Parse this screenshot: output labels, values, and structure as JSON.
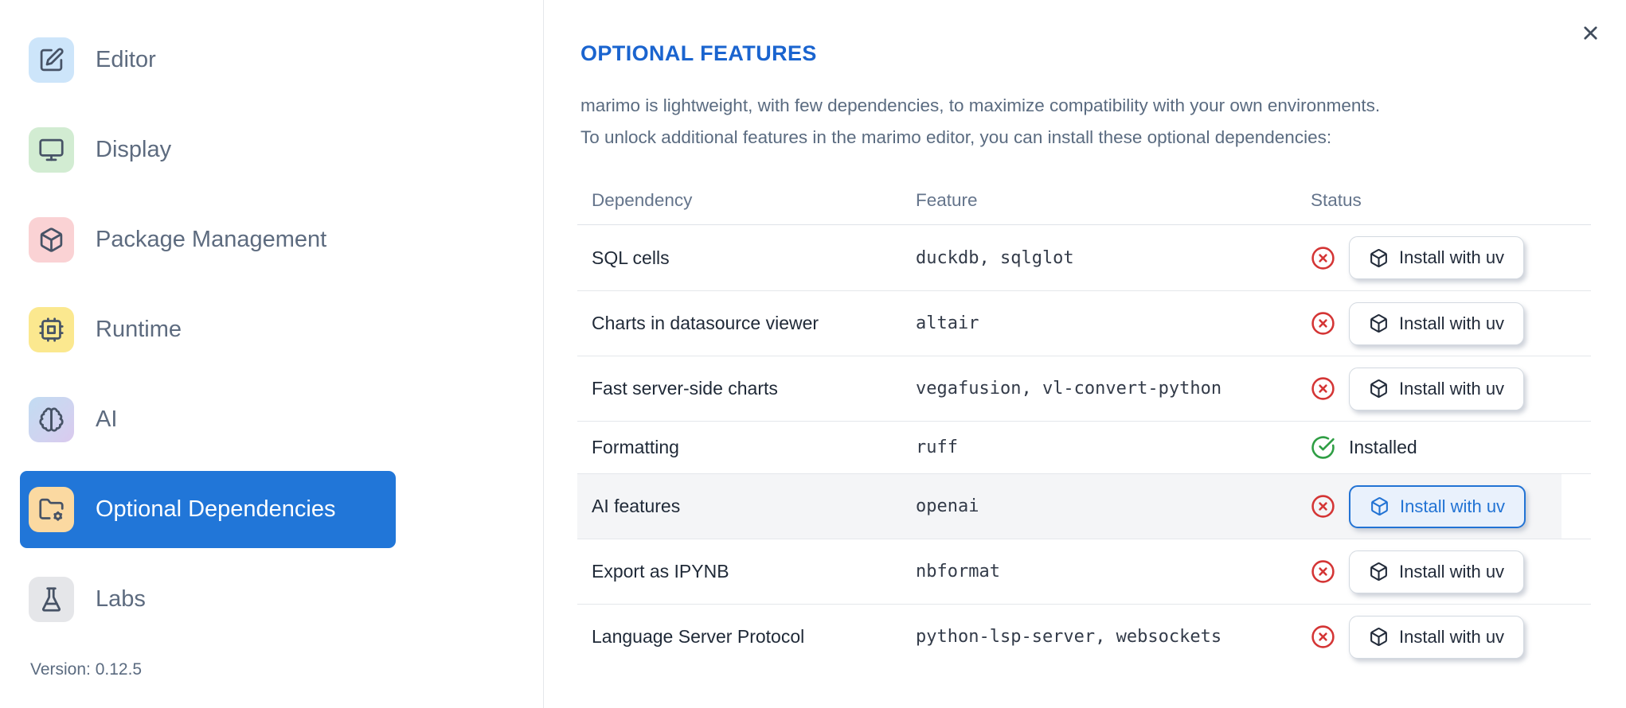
{
  "sidebar": {
    "items": [
      {
        "id": "editor",
        "label": "Editor",
        "icon": "square-pen-icon",
        "icon_bg": "#cde5fa",
        "selected": false
      },
      {
        "id": "display",
        "label": "Display",
        "icon": "monitor-icon",
        "icon_bg": "#d2ecd2",
        "selected": false
      },
      {
        "id": "package-management",
        "label": "Package Management",
        "icon": "package-icon",
        "icon_bg": "#fad2d4",
        "selected": false
      },
      {
        "id": "runtime",
        "label": "Runtime",
        "icon": "cpu-icon",
        "icon_bg": "#fbe88f",
        "selected": false
      },
      {
        "id": "ai",
        "label": "AI",
        "icon": "brain-icon",
        "icon_bg": "linear-gradient(135deg,#c2dcf2 0%,#cfd4f0 55%,#dac9ee 100%)",
        "selected": false
      },
      {
        "id": "optional-dependencies",
        "label": "Optional Dependencies",
        "icon": "folder-cog-icon",
        "icon_bg": "#fbd9a1",
        "selected": true
      },
      {
        "id": "labs",
        "label": "Labs",
        "icon": "flask-icon",
        "icon_bg": "#e5e6e9",
        "selected": false
      }
    ],
    "version_label": "Version: 0.12.5"
  },
  "dialog": {
    "title": "OPTIONAL FEATURES",
    "description_lines": [
      "marimo is lightweight, with few dependencies, to maximize compatibility with your own environments.",
      "To unlock additional features in the marimo editor, you can install these optional dependencies:"
    ]
  },
  "table": {
    "columns": [
      "Dependency",
      "Feature",
      "Status"
    ],
    "rows": [
      {
        "dependency": "SQL cells",
        "feature": "duckdb, sqlglot",
        "installed": false,
        "action_label": "Install with uv",
        "highlighted": false
      },
      {
        "dependency": "Charts in datasource viewer",
        "feature": "altair",
        "installed": false,
        "action_label": "Install with uv",
        "highlighted": false
      },
      {
        "dependency": "Fast server-side charts",
        "feature": "vegafusion, vl-convert-python",
        "installed": false,
        "action_label": "Install with uv",
        "highlighted": false
      },
      {
        "dependency": "Formatting",
        "feature": "ruff",
        "installed": true,
        "status_label": "Installed",
        "highlighted": false
      },
      {
        "dependency": "AI features",
        "feature": "openai",
        "installed": false,
        "action_label": "Install with uv",
        "highlighted": true
      },
      {
        "dependency": "Export as IPYNB",
        "feature": "nbformat",
        "installed": false,
        "action_label": "Install with uv",
        "highlighted": false
      },
      {
        "dependency": "Language Server Protocol",
        "feature": "python-lsp-server, websockets",
        "installed": false,
        "action_label": "Install with uv",
        "highlighted": false
      }
    ]
  },
  "colors": {
    "accent_blue": "#2176d8",
    "title_blue": "#1a64cf",
    "button_blue": "#2273d4",
    "status_red": "#d43535",
    "status_green": "#2f9e44"
  }
}
